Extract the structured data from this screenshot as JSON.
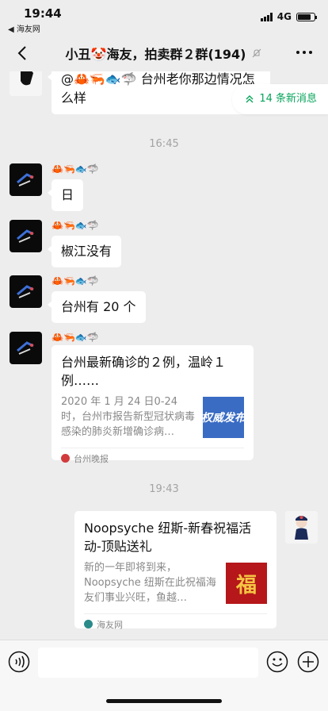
{
  "status_bar": {
    "time": "19:44",
    "back_app": "◀ 海友网",
    "network": "4G",
    "battery_level": 0.8
  },
  "nav": {
    "title": "小丑🤡海友，拍卖群２群(194)",
    "muted_icon": "mute-bell-icon",
    "more_icon": "more-dots-icon"
  },
  "new_messages_pill": "14 条新消息",
  "messages": [
    {
      "sender": "",
      "text": "@🦀🦐🐟🦈 台州老你那边情况怎么样"
    },
    {
      "sender": "🦀🦐🐟🦈",
      "text": "日"
    },
    {
      "sender": "🦀🦐🐟🦈",
      "text": "椒江没有"
    },
    {
      "sender": "🦀🦐🐟🦈",
      "text": "台州有 20 个"
    },
    {
      "sender": "🦀🦐🐟🦈",
      "card": {
        "title": "台州最新确诊的２例，温岭１例……",
        "desc": "2020 年 1 月 24 日0-24 时，台州市报告新型冠状病毒感染的肺炎新增确诊病…",
        "thumb_text": "权威发布",
        "source": "台州晚报"
      }
    },
    {
      "sender": "",
      "card": {
        "title": "Noopsyche 纽斯-新春祝福活动-顶贴送礼",
        "desc": "新的一年即将到来，Noopsyche 纽斯在此祝福海友们事业兴旺，鱼越…",
        "thumb_text": "福",
        "source": "海友网"
      }
    }
  ],
  "timestamps": [
    "16:45",
    "19:43"
  ],
  "input_bar": {
    "value": "",
    "voice_icon": "voice-icon",
    "emoji_icon": "emoji-icon",
    "plus_icon": "plus-icon"
  },
  "colors": {
    "accent_green": "#07a55b",
    "chat_bg": "#ededed",
    "bubble_bg": "#ffffff"
  }
}
